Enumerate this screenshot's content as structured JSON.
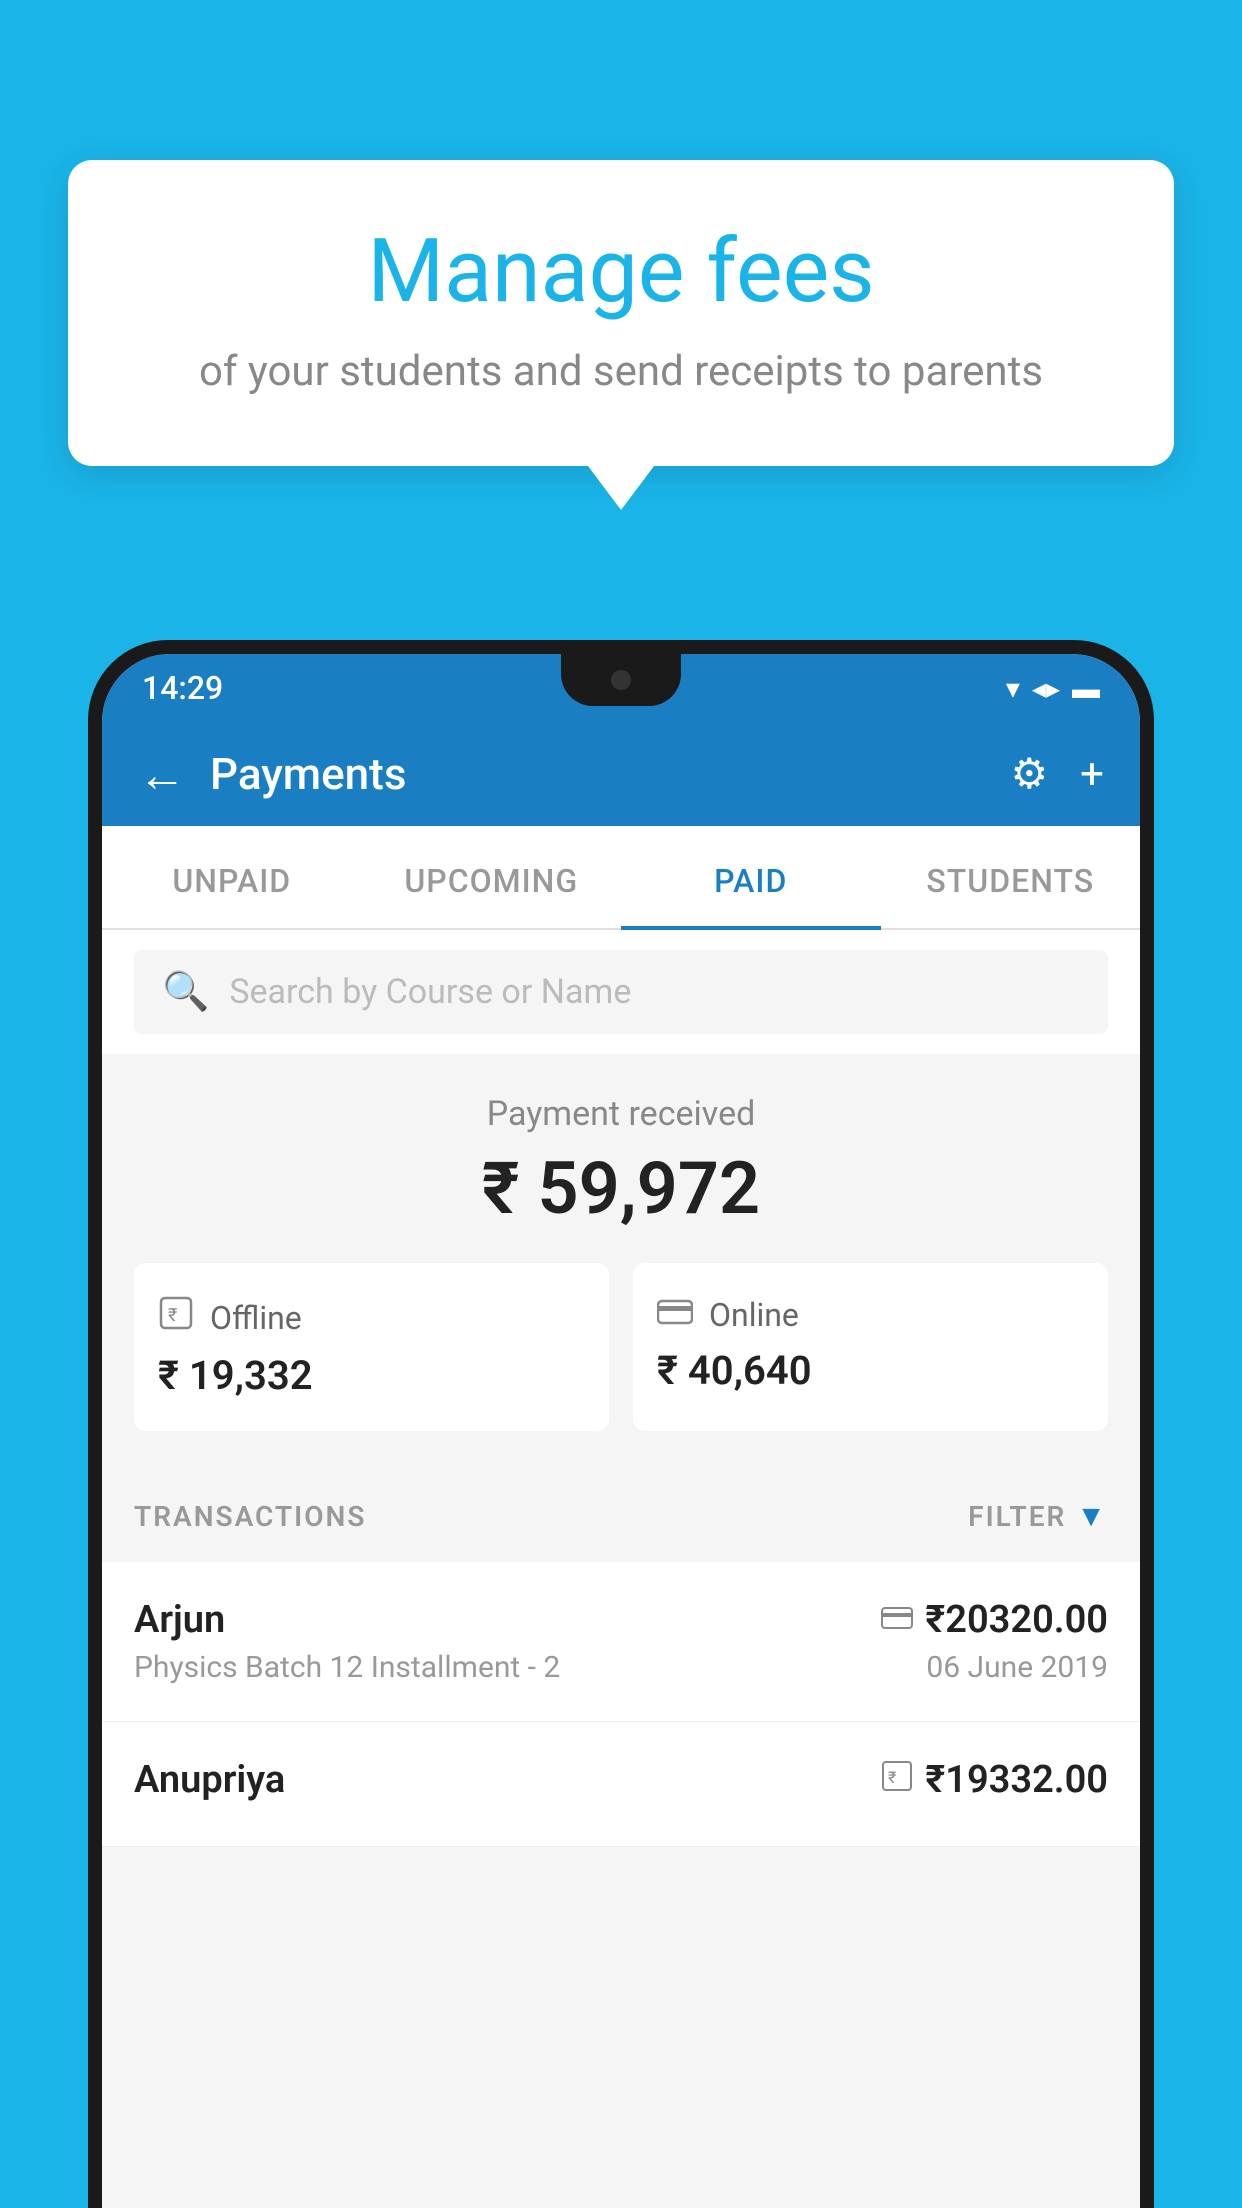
{
  "background_color": "#1ab4e8",
  "bubble": {
    "title": "Manage fees",
    "subtitle": "of your students and send receipts to parents"
  },
  "phone": {
    "status_bar": {
      "time": "14:29",
      "icons": [
        "wifi",
        "signal",
        "battery"
      ]
    },
    "header": {
      "back_label": "←",
      "title": "Payments",
      "settings_icon": "⚙",
      "add_icon": "+"
    },
    "tabs": [
      {
        "label": "UNPAID",
        "active": false
      },
      {
        "label": "UPCOMING",
        "active": false
      },
      {
        "label": "PAID",
        "active": true
      },
      {
        "label": "STUDENTS",
        "active": false
      }
    ],
    "search": {
      "placeholder": "Search by Course or Name"
    },
    "payment_summary": {
      "label": "Payment received",
      "total": "₹ 59,972",
      "offline": {
        "icon": "💳",
        "label": "Offline",
        "amount": "₹ 19,332"
      },
      "online": {
        "icon": "💳",
        "label": "Online",
        "amount": "₹ 40,640"
      }
    },
    "transactions": {
      "section_label": "TRANSACTIONS",
      "filter_label": "FILTER",
      "items": [
        {
          "name": "Arjun",
          "detail": "Physics Batch 12 Installment - 2",
          "amount": "₹20320.00",
          "date": "06 June 2019",
          "payment_type": "online"
        },
        {
          "name": "Anupriya",
          "detail": "",
          "amount": "₹19332.00",
          "date": "",
          "payment_type": "offline"
        }
      ]
    }
  }
}
